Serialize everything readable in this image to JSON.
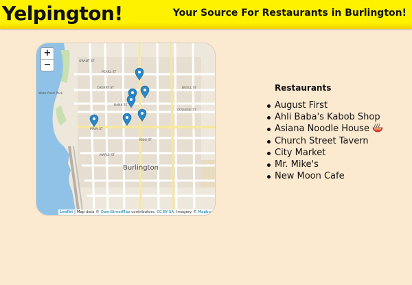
{
  "header": {
    "brand": "Yelpington!",
    "tagline": "Your Source For Restaurants in Burlington!"
  },
  "map": {
    "zoom_in": "+",
    "zoom_out": "−",
    "city_label": "Burlington",
    "street_labels": [
      "PEARL ST",
      "CHERRY ST",
      "BANK ST",
      "COLLEGE ST",
      "MAIN ST",
      "KING ST",
      "MAPLE ST",
      "UNION ST",
      "WILLARD ST",
      "BATTERY ST",
      "GRANT ST",
      "BUELL ST"
    ],
    "waterfront_label": "Waterfront Park",
    "attribution": {
      "leaflet": "Leaflet",
      "text1": " | Map data © ",
      "osm": "OpenStreetMap",
      "text2": " contributors, ",
      "license": "CC-BY-SA",
      "text3": ", Imagery © ",
      "provider": "Mapbox"
    },
    "marker_color": "#2a87c8",
    "marker_count": 7
  },
  "restaurants": {
    "title": "Restaurants",
    "items": [
      "August First",
      "Ahli Baba's Kabob Shop",
      "Asiana Noodle House",
      "Church Street Tavern",
      "City Market",
      "Mr. Mike's",
      "New Moon Cafe"
    ],
    "noodle_icon": "noodle-bowl-icon"
  }
}
